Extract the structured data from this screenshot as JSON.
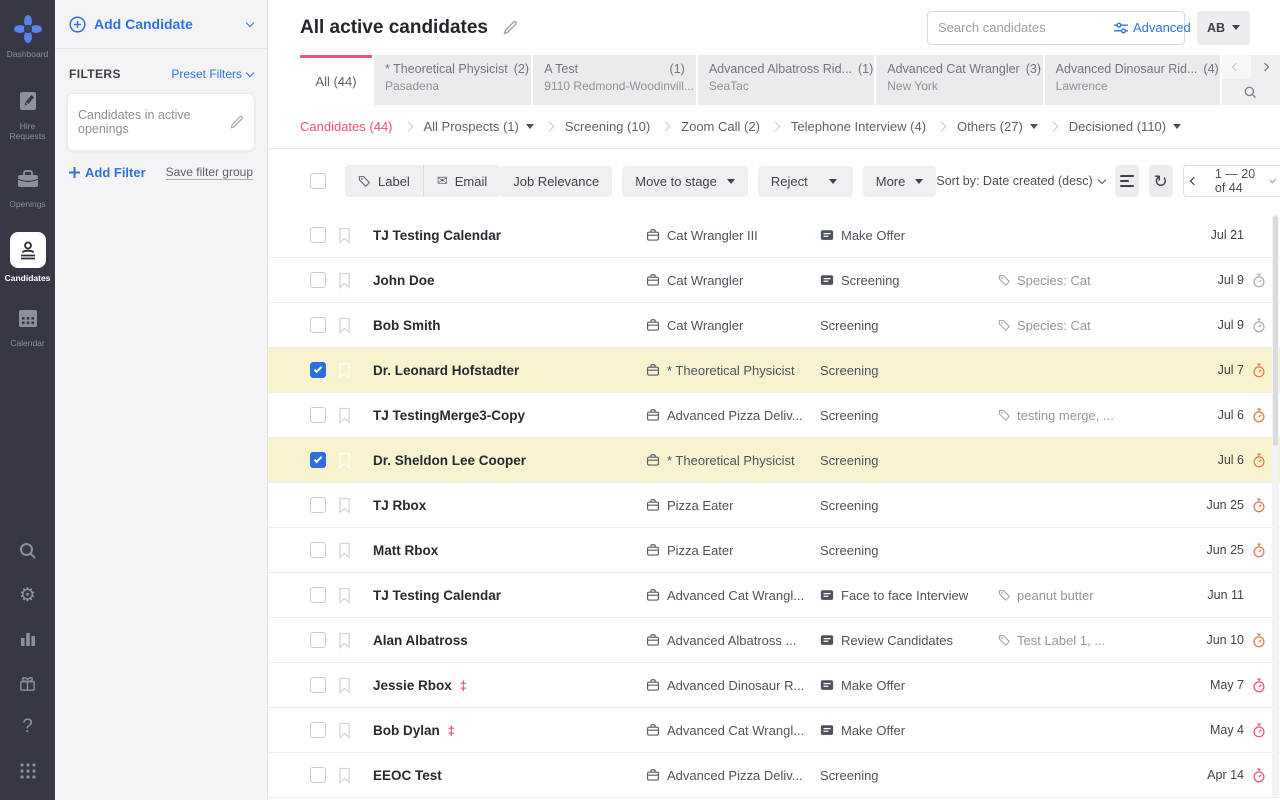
{
  "icons": {
    "email": "✉",
    "refresh": "↻",
    "gear": "⚙",
    "help": "?"
  },
  "sidebar": {
    "items": [
      {
        "label": "Dashboard"
      },
      {
        "label": "Hire Requests"
      },
      {
        "label": "Openings"
      },
      {
        "label": "Candidates",
        "active": true
      },
      {
        "label": "Calendar"
      }
    ]
  },
  "filter_panel": {
    "add_candidate": "Add Candidate",
    "filters_title": "FILTERS",
    "preset_filters": "Preset Filters",
    "active_filter": "Candidates in active openings",
    "add_filter": "Add Filter",
    "save_filter_group": "Save filter group"
  },
  "header": {
    "title": "All active candidates",
    "search_placeholder": "Search candidates",
    "advanced_label": "Advanced",
    "avatar": "AB"
  },
  "tabs": [
    {
      "label": "All (44)",
      "active": true
    },
    {
      "name": "* Theoretical Physicist",
      "count": "(2)",
      "location": "Pasadena"
    },
    {
      "name": "A Test",
      "count": "(1)",
      "location": "9110 Redmond-Woodinvill..."
    },
    {
      "name": "Advanced Albatross Rid...",
      "count": "(1)",
      "location": "SeaTac"
    },
    {
      "name": "Advanced Cat Wrangler",
      "count": "(3)",
      "location": "New York"
    },
    {
      "name": "Advanced Dinosaur Rid...",
      "count": "(4)",
      "location": "Lawrence"
    }
  ],
  "stages": [
    {
      "label": "Candidates (44)",
      "highlight": true
    },
    {
      "label": "All Prospects (1)",
      "caret": true
    },
    {
      "label": "Screening (10)"
    },
    {
      "label": "Zoom Call (2)"
    },
    {
      "label": "Telephone Interview (4)"
    },
    {
      "label": "Others (27)",
      "caret": true
    },
    {
      "label": "Decisioned (110)",
      "caret": true
    }
  ],
  "toolbar": {
    "label": "Label",
    "email": "Email",
    "job_relevance": "Job Relevance",
    "move_to_stage": "Move to stage",
    "reject": "Reject",
    "more": "More",
    "sort_by": "Sort by: Date created (desc)",
    "pagination": "1 — 20 of 44"
  },
  "rows": [
    {
      "name": "TJ Testing Calendar",
      "job": "Cat Wrangler III",
      "stage": "Make Offer",
      "stage_icon": true,
      "label": "",
      "date": "Jul 21",
      "clock": "none"
    },
    {
      "name": "John Doe",
      "job": "Cat Wrangler",
      "stage": "Screening",
      "stage_icon": true,
      "label": "Species: Cat",
      "date": "Jul 9",
      "clock": "gray"
    },
    {
      "name": "Bob Smith",
      "job": "Cat Wrangler",
      "stage": "Screening",
      "stage_icon": false,
      "label": "Species: Cat",
      "date": "Jul 9",
      "clock": "gray"
    },
    {
      "name": "Dr. Leonard Hofstadter",
      "job": "* Theoretical Physicist",
      "stage": "Screening",
      "stage_icon": false,
      "label": "",
      "date": "Jul 7",
      "clock": "orange",
      "checked": true,
      "highlighted": true
    },
    {
      "name": "TJ TestingMerge3-Copy",
      "job": "Advanced Pizza Deliv...",
      "stage": "Screening",
      "stage_icon": false,
      "label": "testing merge, ...",
      "date": "Jul 6",
      "clock": "orange"
    },
    {
      "name": "Dr. Sheldon Lee Cooper",
      "job": "* Theoretical Physicist",
      "stage": "Screening",
      "stage_icon": false,
      "label": "",
      "date": "Jul 6",
      "clock": "orange",
      "checked": true,
      "highlighted": true
    },
    {
      "name": "TJ Rbox",
      "job": "Pizza Eater",
      "stage": "Screening",
      "stage_icon": false,
      "label": "",
      "date": "Jun 25",
      "clock": "orange"
    },
    {
      "name": "Matt Rbox",
      "job": "Pizza Eater",
      "stage": "Screening",
      "stage_icon": false,
      "label": "",
      "date": "Jun 25",
      "clock": "orange"
    },
    {
      "name": "TJ Testing Calendar",
      "job": "Advanced Cat Wrangl...",
      "stage": "Face to face Interview",
      "stage_icon": true,
      "label": "peanut butter",
      "date": "Jun 11",
      "clock": "none"
    },
    {
      "name": "Alan Albatross",
      "job": "Advanced Albatross ...",
      "stage": "Review Candidates",
      "stage_icon": true,
      "label": "Test Label 1, ...",
      "date": "Jun 10",
      "clock": "orange"
    },
    {
      "name": "Jessie Rbox",
      "flag": "‡",
      "job": "Advanced Dinosaur R...",
      "stage": "Make Offer",
      "stage_icon": true,
      "label": "",
      "date": "May 7",
      "clock": "red"
    },
    {
      "name": "Bob Dylan",
      "flag": "‡",
      "job": "Advanced Cat Wrangl...",
      "stage": "Make Offer",
      "stage_icon": true,
      "label": "",
      "date": "May 4",
      "clock": "red"
    },
    {
      "name": "EEOC Test",
      "job": "Advanced Pizza Deliv...",
      "stage": "Screening",
      "stage_icon": false,
      "label": "",
      "date": "Apr 14",
      "clock": "red"
    }
  ]
}
